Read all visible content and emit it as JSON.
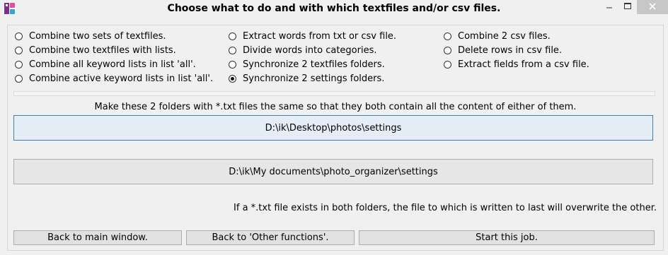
{
  "window": {
    "title": "Choose what to do and with which textfiles and/or csv files."
  },
  "options": {
    "col1": [
      {
        "label": "Combine two sets of textfiles.",
        "selected": false
      },
      {
        "label": "Combine two textfiles with lists.",
        "selected": false
      },
      {
        "label": "Combine all keyword lists in list 'all'.",
        "selected": false
      },
      {
        "label": "Combine active keyword lists in list 'all'.",
        "selected": false
      }
    ],
    "col2": [
      {
        "label": "Extract words from txt or csv file.",
        "selected": false
      },
      {
        "label": "Divide words into categories.",
        "selected": false
      },
      {
        "label": "Synchronize 2 textfiles folders.",
        "selected": false
      },
      {
        "label": "Synchronize 2 settings folders.",
        "selected": true
      }
    ],
    "col3": [
      {
        "label": "Combine 2 csv files.",
        "selected": false
      },
      {
        "label": "Delete rows in csv file.",
        "selected": false
      },
      {
        "label": "Extract fields from a csv file.",
        "selected": false
      }
    ]
  },
  "description": "Make these 2 folders with *.txt files the same so that they both contain all the content of either of them.",
  "folders": {
    "first": "D:\\ik\\Desktop\\photos\\settings",
    "second": "D:\\ik\\My documents\\photo_organizer\\settings"
  },
  "note": "If a *.txt file exists in both folders, the file to which is written to last will overwrite the other.",
  "buttons": {
    "back_main": "Back to main window.",
    "back_other": "Back to 'Other functions'.",
    "start": "Start this job."
  }
}
